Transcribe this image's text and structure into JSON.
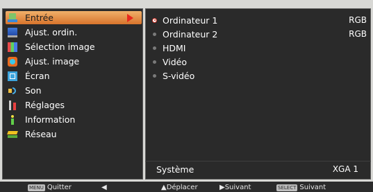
{
  "main_menu": {
    "items": [
      {
        "label": "Entrée",
        "icon": "input-icon",
        "selected": true
      },
      {
        "label": "Ajust. ordin.",
        "icon": "computer-adjust-icon"
      },
      {
        "label": "Sélection image",
        "icon": "image-select-icon"
      },
      {
        "label": "Ajust. image",
        "icon": "image-adjust-icon"
      },
      {
        "label": "Écran",
        "icon": "screen-icon"
      },
      {
        "label": "Son",
        "icon": "sound-icon"
      },
      {
        "label": "Réglages",
        "icon": "settings-icon"
      },
      {
        "label": "Information",
        "icon": "information-icon"
      },
      {
        "label": "Réseau",
        "icon": "network-icon"
      }
    ]
  },
  "submenu": {
    "items": [
      {
        "label": "Ordinateur 1",
        "signal": "RGB",
        "active": true
      },
      {
        "label": "Ordinateur 2",
        "signal": "RGB"
      },
      {
        "label": "HDMI",
        "signal": ""
      },
      {
        "label": "Vidéo",
        "signal": ""
      },
      {
        "label": "S-vidéo",
        "signal": ""
      }
    ],
    "system_label": "Système",
    "system_value": "XGA 1"
  },
  "footer": {
    "menu_key": "MENU",
    "quit_label": "Quitter",
    "move_label": "Déplacer",
    "next_label": "Suivant",
    "select_key": "SELECT",
    "select_label": "Suivant"
  },
  "colors": {
    "selection_gradient": [
      "#f0b06a",
      "#d8742c"
    ],
    "selection_arrow": "#e8281e",
    "panel_bg": "#2a2a2a"
  }
}
